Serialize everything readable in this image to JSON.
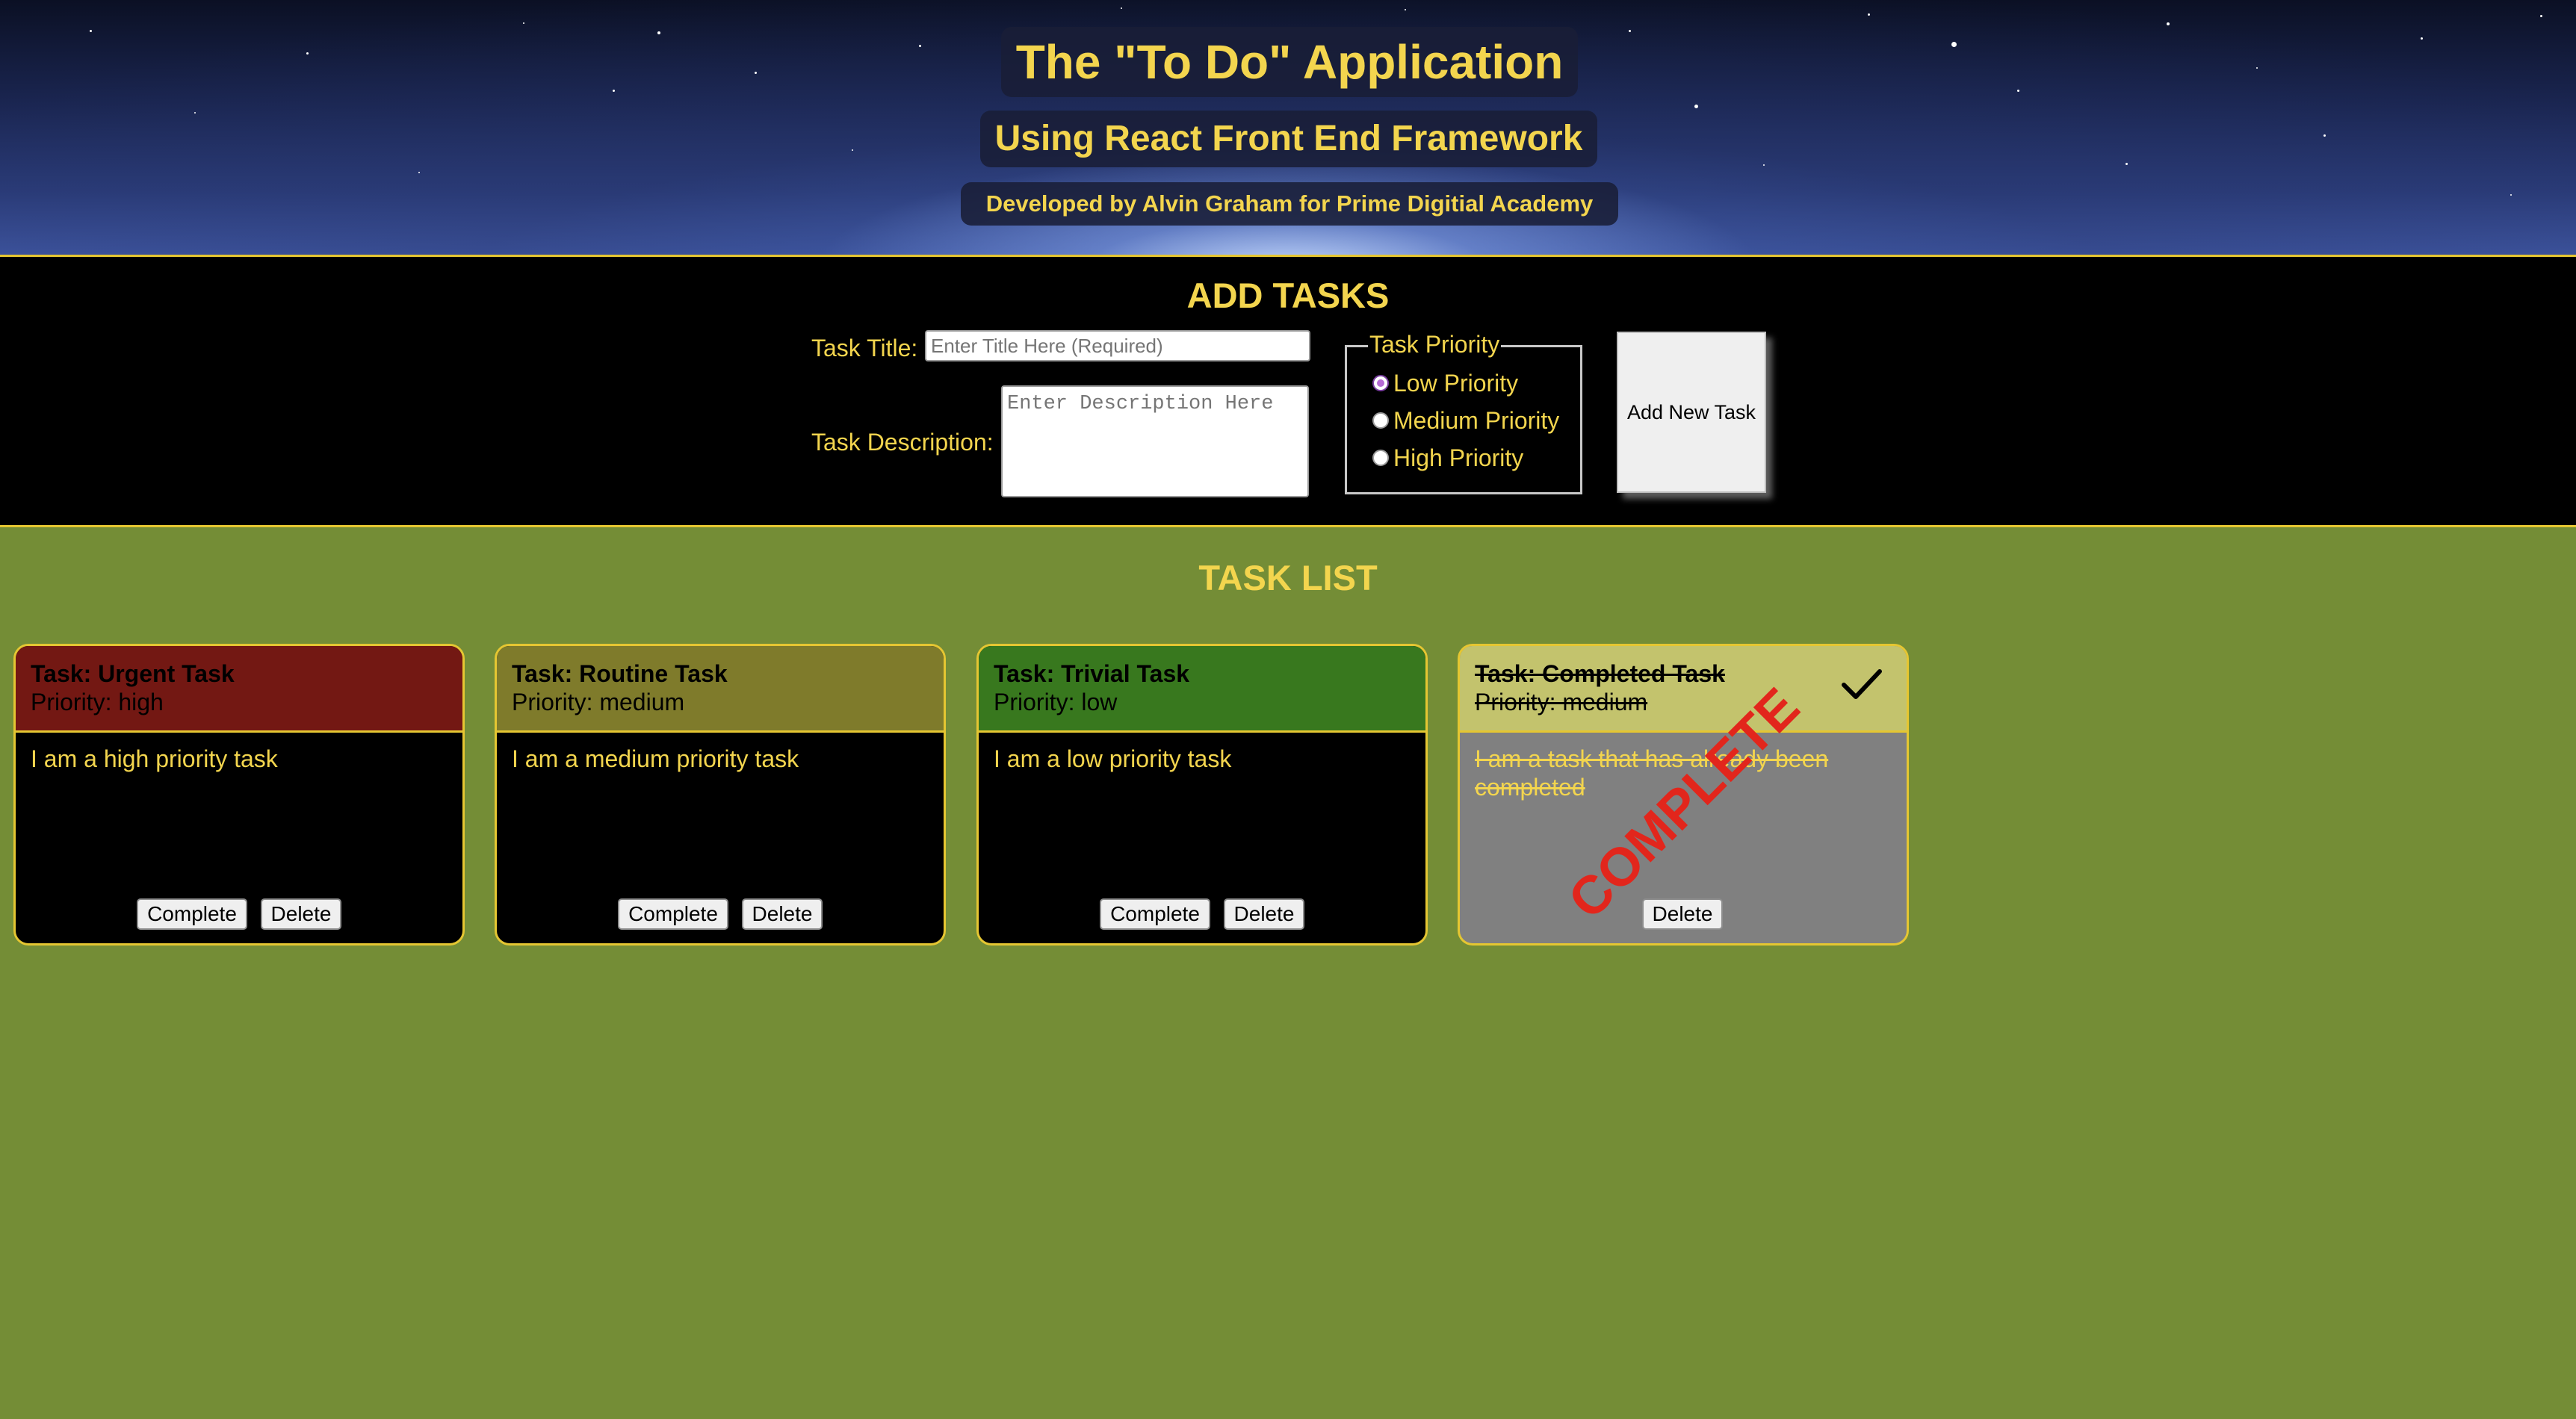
{
  "header": {
    "title": "The \"To Do\" Application",
    "subtitle": "Using React Front End Framework",
    "credit": "Developed by Alvin Graham for Prime Digitial Academy"
  },
  "add_section": {
    "heading": "ADD TASKS",
    "title_label": "Task Title:",
    "title_placeholder": "Enter Title Here (Required)",
    "title_value": "",
    "description_label": "Task Description:",
    "description_placeholder": "Enter Description Here",
    "description_value": "",
    "priority_legend": "Task Priority",
    "priority_options": [
      "Low Priority",
      "Medium Priority",
      "High Priority"
    ],
    "priority_selected": "Low Priority",
    "add_button_label": "Add New Task"
  },
  "task_list": {
    "heading": "TASK LIST",
    "tasks": [
      {
        "title": "Task: Urgent Task",
        "priority": "Priority: high",
        "description": "I am a high priority task",
        "complete_label": "Complete",
        "delete_label": "Delete",
        "header_color": "#731813",
        "completed": false
      },
      {
        "title": "Task: Routine Task",
        "priority": "Priority: medium",
        "description": "I am a medium priority task",
        "complete_label": "Complete",
        "delete_label": "Delete",
        "header_color": "#7f7b2b",
        "completed": false
      },
      {
        "title": "Task: Trivial Task",
        "priority": "Priority: low",
        "description": "I am a low priority task",
        "complete_label": "Complete",
        "delete_label": "Delete",
        "header_color": "#38781e",
        "completed": false
      },
      {
        "title": "Task: Completed Task",
        "priority": "Priority: medium",
        "description": "I am a task that has already been completed",
        "delete_label": "Delete",
        "stamp": "COMPLETE",
        "status_icon": "checkmark-icon",
        "header_color": "#c3c36d",
        "completed": true
      }
    ]
  },
  "colors": {
    "accent_text": "#f3d54e",
    "page_background": "#748d36",
    "section_background": "#000000",
    "border": "#e5c632",
    "stamp": "#e2261c",
    "completed_card_body": "#808080"
  }
}
